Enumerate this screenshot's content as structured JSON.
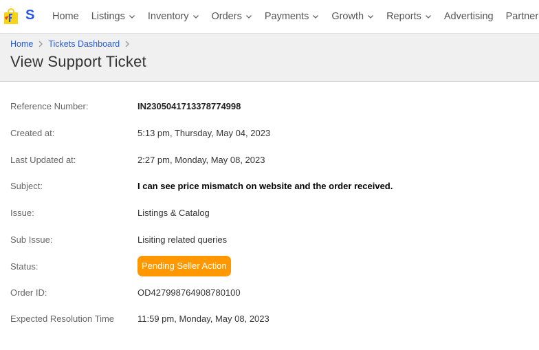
{
  "brand": {
    "logo_letter": "S",
    "logo_colors": {
      "bag": "#f7d417",
      "arrow": "#2a55e5"
    }
  },
  "nav": {
    "items": [
      {
        "label": "Home",
        "dropdown": false
      },
      {
        "label": "Listings",
        "dropdown": true
      },
      {
        "label": "Inventory",
        "dropdown": true
      },
      {
        "label": "Orders",
        "dropdown": true
      },
      {
        "label": "Payments",
        "dropdown": true
      },
      {
        "label": "Growth",
        "dropdown": true
      },
      {
        "label": "Reports",
        "dropdown": true
      },
      {
        "label": "Advertising",
        "dropdown": false
      },
      {
        "label": "Partner",
        "dropdown": false
      }
    ]
  },
  "breadcrumb": {
    "items": [
      "Home",
      "Tickets Dashboard"
    ]
  },
  "page": {
    "title": "View Support Ticket"
  },
  "ticket": {
    "fields": [
      {
        "label": "Reference Number:",
        "value": "IN2305041713378774998",
        "style": "bold"
      },
      {
        "label": "Created at:",
        "value": "5:13 pm, Thursday, May 04, 2023",
        "style": "normal"
      },
      {
        "label": "Last Updated at:",
        "value": "2:27 pm, Monday, May 08, 2023",
        "style": "normal"
      },
      {
        "label": "Subject:",
        "value": "I can see price mismatch on website and the order received.",
        "style": "strong"
      },
      {
        "label": "Issue:",
        "value": "Listings & Catalog",
        "style": "normal"
      },
      {
        "label": "Sub Issue:",
        "value": "Lisiting related queries",
        "style": "normal"
      },
      {
        "label": "Status:",
        "value": "Pending Seller Action",
        "style": "badge"
      },
      {
        "label": "Order ID:",
        "value": "OD427998764908780100",
        "style": "normal"
      },
      {
        "label": "Expected Resolution Time",
        "value": "11:59 pm, Monday, May 08, 2023",
        "style": "normal"
      }
    ]
  },
  "colors": {
    "status_badge": "#ff9800",
    "link": "#2a5bd7",
    "header_band": "#f0f0f0"
  }
}
